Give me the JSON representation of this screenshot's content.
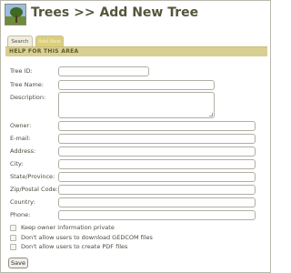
{
  "header": {
    "title": "Trees >> Add New Tree",
    "logo": "tree-logo"
  },
  "tabs": [
    {
      "label": "Search",
      "active": false
    },
    {
      "label": "Add New",
      "active": true
    }
  ],
  "help_bar": {
    "label": "Help for this area"
  },
  "form": {
    "fields": [
      {
        "label": "Tree ID:",
        "value": ""
      },
      {
        "label": "Tree Name:",
        "value": ""
      },
      {
        "label": "Description:",
        "value": ""
      },
      {
        "label": "Owner:",
        "value": ""
      },
      {
        "label": "E-mail:",
        "value": ""
      },
      {
        "label": "Address:",
        "value": ""
      },
      {
        "label": "City:",
        "value": ""
      },
      {
        "label": "State/Province:",
        "value": ""
      },
      {
        "label": "Zip/Postal Code:",
        "value": ""
      },
      {
        "label": "Country:",
        "value": ""
      },
      {
        "label": "Phone:",
        "value": ""
      }
    ],
    "checkboxes": [
      {
        "label": "Keep owner information private",
        "checked": false
      },
      {
        "label": "Don't allow users to download GEDCOM files",
        "checked": false
      },
      {
        "label": "Don't allow users to create PDF files",
        "checked": false
      }
    ],
    "save_label": "Save"
  },
  "colors": {
    "title": "#55553c",
    "help_bar": "#d8cf92",
    "active_tab": "#ddcf7a"
  }
}
